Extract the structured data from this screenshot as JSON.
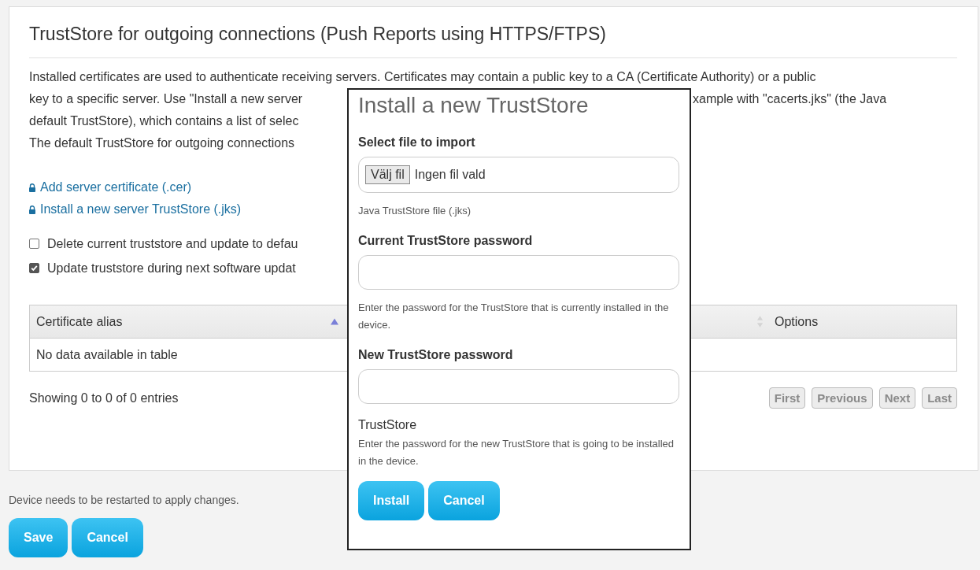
{
  "card": {
    "title": "TrustStore for outgoing connections (Push Reports using HTTPS/FTPS)",
    "description_lines": [
      {
        "kind": "full",
        "left": "Installed certificates are used to authenticate receiving servers. Certificates may contain a public key to a CA (Certificate Authority) or a public"
      },
      {
        "kind": "split",
        "left": "key to a specific server. Use \"Install a new server",
        "right": "xample with \"cacerts.jks\" (the Java"
      },
      {
        "kind": "split",
        "left": "default TrustStore), which contains a list of selec"
      },
      {
        "kind": "split",
        "left": "The default TrustStore for outgoing connections"
      }
    ],
    "links": [
      {
        "text": "Add server certificate (.cer)"
      },
      {
        "text": "Install a new server TrustStore (.jks)"
      }
    ],
    "checkboxes": [
      {
        "label": "Delete current truststore and update to defau",
        "checked": false
      },
      {
        "label": "Update truststore during next software updat",
        "checked": true
      }
    ],
    "table": {
      "columns": [
        {
          "label": "Certificate alias",
          "sorted_ascending": true
        },
        {
          "sorted_ascending": false
        },
        {
          "label": "Options"
        }
      ],
      "empty_message": "No data available in table"
    },
    "info": "Showing 0 to 0 of 0 entries",
    "pagination": [
      {
        "label": "First",
        "disabled": true
      },
      {
        "label": "Previous",
        "disabled": true
      },
      {
        "label": "Next",
        "disabled": true
      },
      {
        "label": "Last",
        "disabled": true
      }
    ]
  },
  "footer": {
    "note": "Device needs to be restarted to apply changes.",
    "buttons": [
      "Save",
      "Cancel"
    ]
  },
  "modal": {
    "title": "Install a new TrustStore",
    "fields": [
      {
        "kind": "file",
        "label": "Select file to import",
        "button": "Välj fil",
        "value": "Ingen fil vald",
        "help": "Java TrustStore file (.jks)"
      },
      {
        "kind": "password",
        "label": "Current TrustStore password",
        "help": "Enter the password for the TrustStore that is currently installed in the device."
      },
      {
        "kind": "password",
        "label": "New TrustStore password",
        "note": "TrustStore",
        "help": "Enter the password for the new TrustStore that is going to be installed in the device."
      }
    ],
    "buttons": [
      "Install",
      "Cancel"
    ]
  }
}
